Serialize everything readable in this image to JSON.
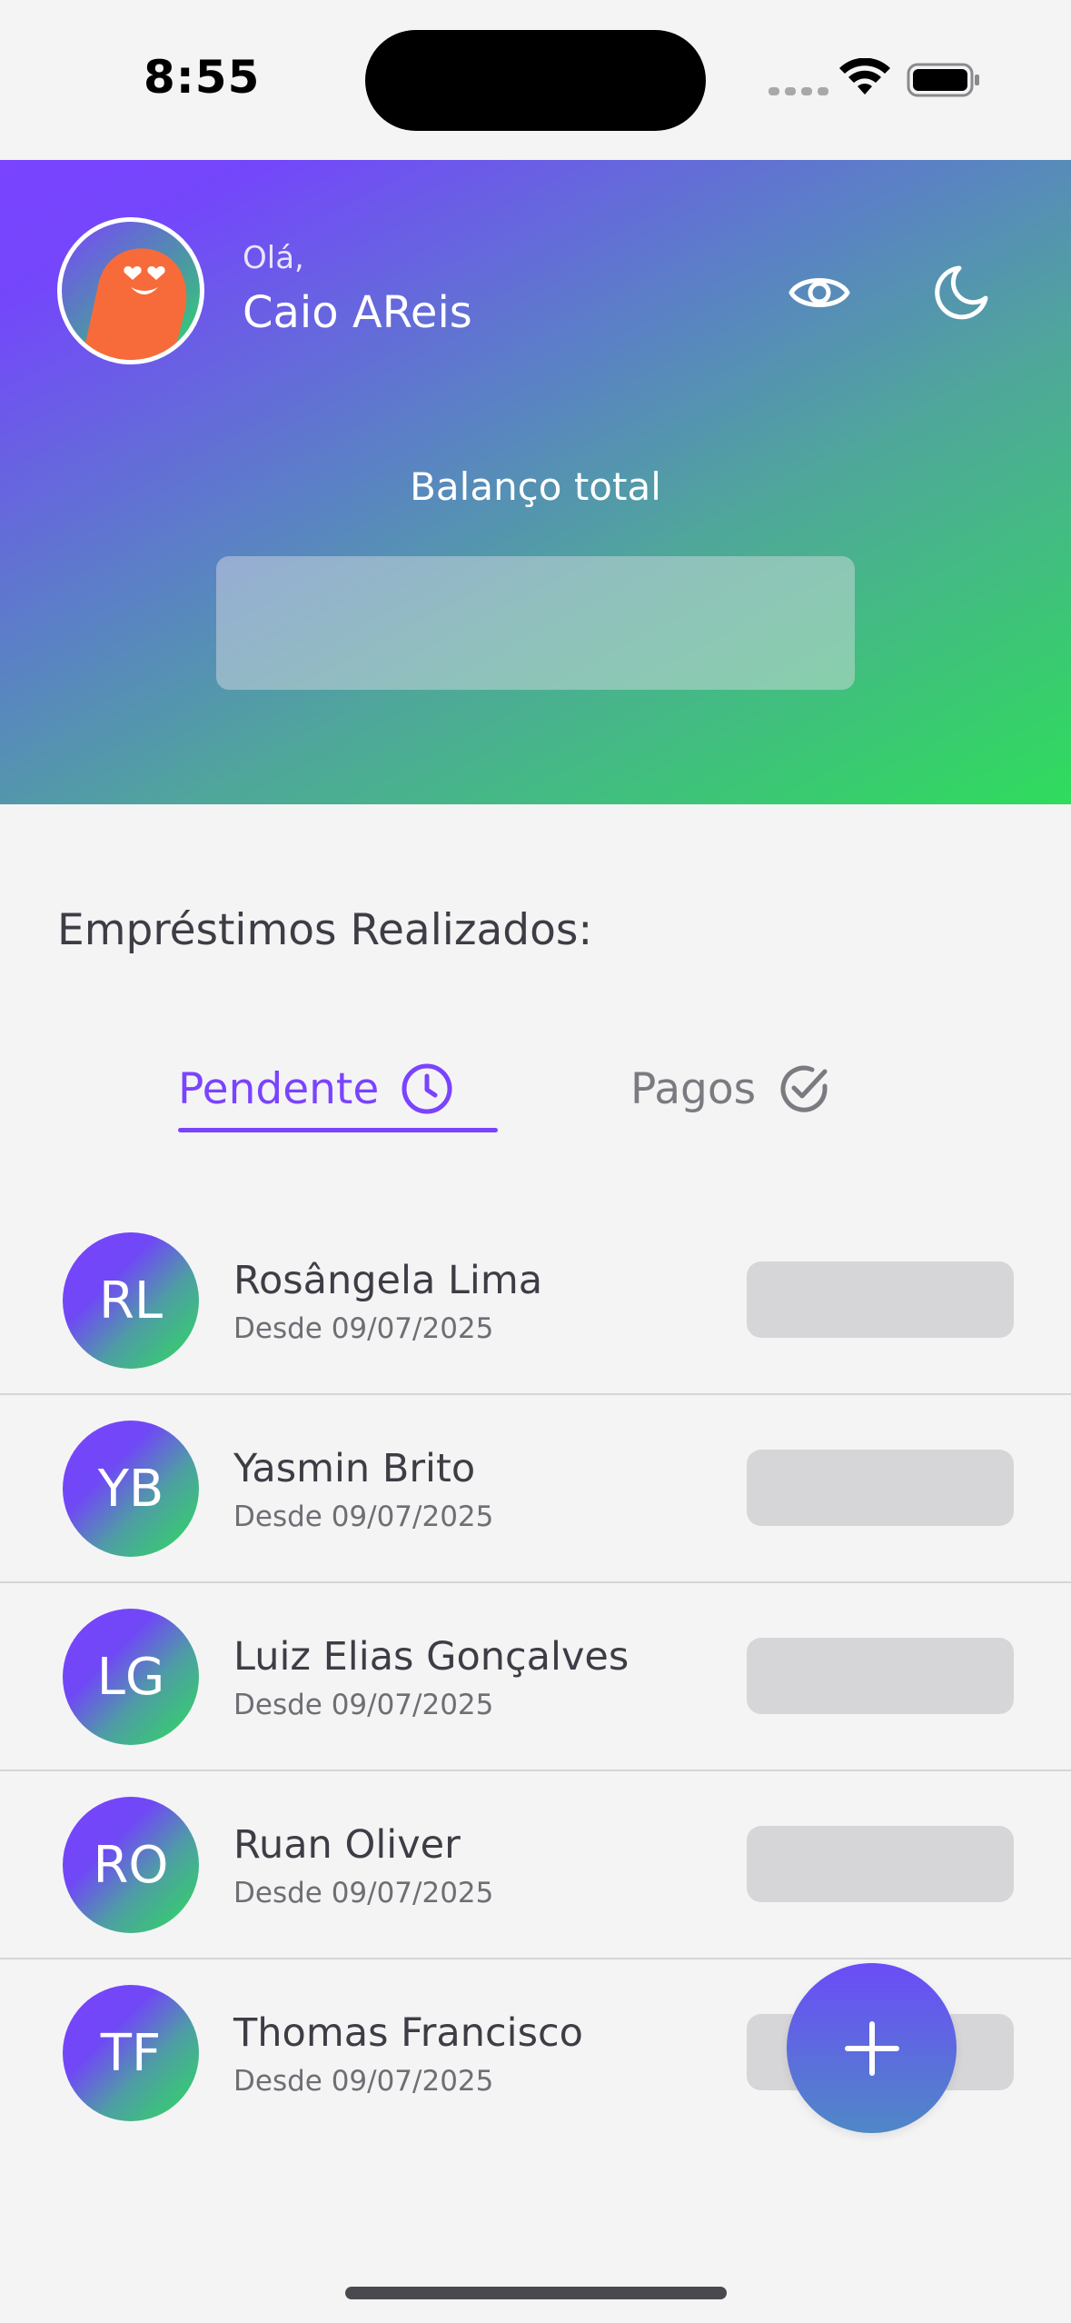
{
  "status_bar": {
    "time": "8:55"
  },
  "header": {
    "greeting": "Olá,",
    "user_name": "Caio AReis",
    "balance_label": "Balanço total",
    "icons": {
      "visibility": "eye-icon",
      "theme": "moon-icon"
    }
  },
  "section": {
    "title": "Empréstimos Realizados:"
  },
  "tabs": [
    {
      "label": "Pendente",
      "icon": "clock-icon",
      "active": true
    },
    {
      "label": "Pagos",
      "icon": "check-circle-icon",
      "active": false
    }
  ],
  "loans": [
    {
      "initials": "RL",
      "name": "Rosângela Lima",
      "since": "Desde 09/07/2025"
    },
    {
      "initials": "YB",
      "name": "Yasmin Brito",
      "since": "Desde 09/07/2025"
    },
    {
      "initials": "LG",
      "name": "Luiz Elias Gonçalves",
      "since": "Desde 09/07/2025"
    },
    {
      "initials": "RO",
      "name": "Ruan Oliver",
      "since": "Desde 09/07/2025"
    },
    {
      "initials": "TF",
      "name": "Thomas Francisco",
      "since": "Desde 09/07/2025"
    }
  ],
  "fab": {
    "icon": "plus-icon"
  },
  "colors": {
    "accent": "#7a43ff",
    "gradient_start": "#7a43ff",
    "gradient_end": "#2fdc5c",
    "background": "#f4f4f5"
  }
}
